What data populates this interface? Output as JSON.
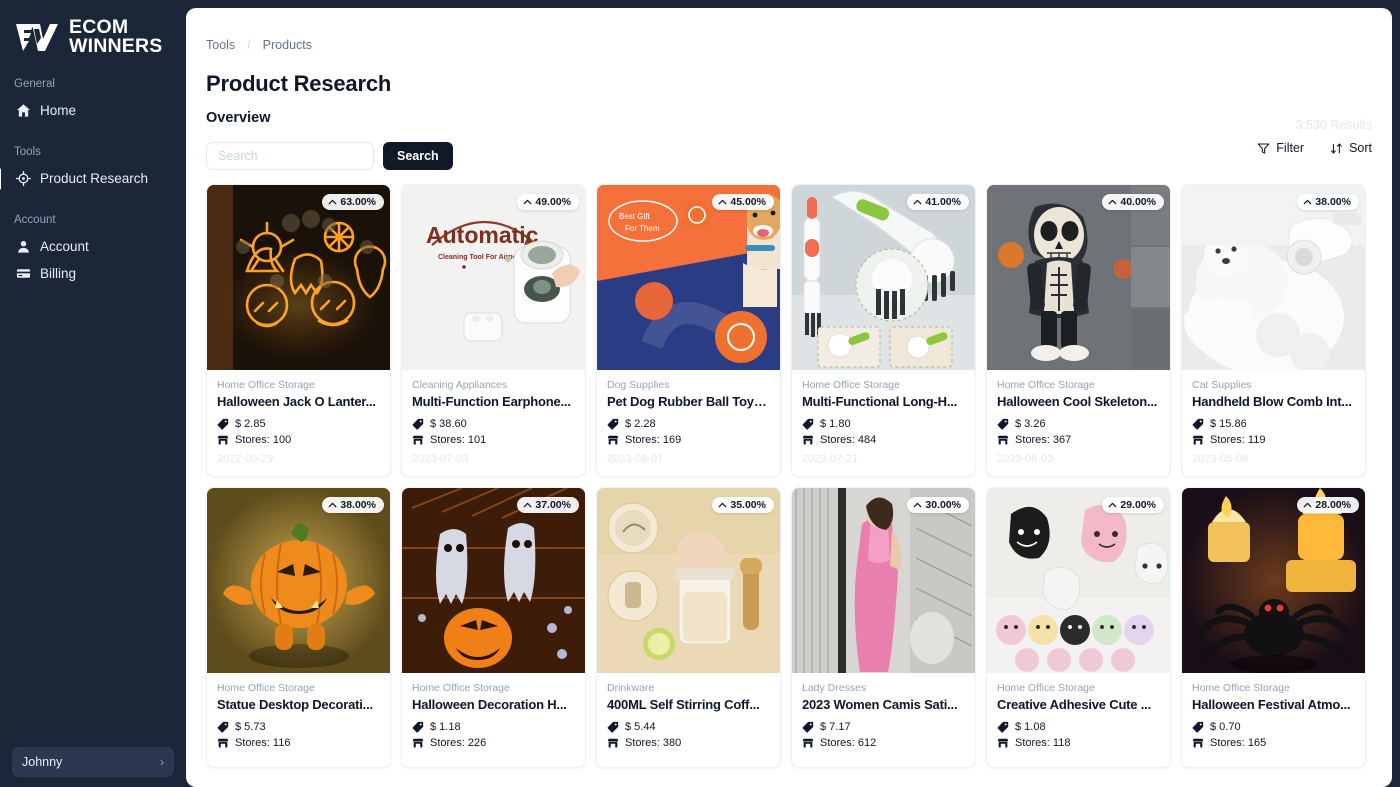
{
  "brand": {
    "name_line1": "ECOM",
    "name_line2": "WINNERS",
    "logo_icon": "ew-logo-icon"
  },
  "sidebar": {
    "sections": [
      {
        "label": "General",
        "items": [
          {
            "label": "Home",
            "icon": "home-icon",
            "active": false
          }
        ]
      },
      {
        "label": "Tools",
        "items": [
          {
            "label": "Product Research",
            "icon": "target-icon",
            "active": true
          }
        ]
      },
      {
        "label": "Account",
        "items": [
          {
            "label": "Account",
            "icon": "user-icon",
            "active": false
          },
          {
            "label": "Billing",
            "icon": "credit-card-icon",
            "active": false
          }
        ]
      }
    ],
    "user": {
      "name": "Johnny",
      "chevron": "›"
    }
  },
  "breadcrumb": {
    "items": [
      "Tools",
      "Products"
    ],
    "separator": "/"
  },
  "header": {
    "title": "Product Research",
    "section": "Overview"
  },
  "search": {
    "value": "",
    "placeholder": "Search",
    "button_label": "Search"
  },
  "toolbar": {
    "results_text": "3.530 Results",
    "filter_label": "Filter",
    "filter_icon": "filter-icon",
    "sort_label": "Sort",
    "sort_icon": "sort-icon"
  },
  "card_meta": {
    "price_icon": "price-tag-icon",
    "stores_icon": "store-icon",
    "badge_caret": "caret-up-icon",
    "stores_prefix": "Stores: ",
    "currency": "$"
  },
  "products": [
    {
      "badge": "63.00%",
      "category": "Home Office Storage",
      "name": "Halloween Jack O Lanter...",
      "price": "$ 2.85",
      "stores": "Stores: 100",
      "date": "2022-09-29",
      "img": "halloween-lights"
    },
    {
      "badge": "49.00%",
      "category": "Cleaning Appliances",
      "name": "Multi-Function Earphone...",
      "price": "$ 38.60",
      "stores": "Stores: 101",
      "date": "2023-07-03",
      "img": "earphone-cleaner"
    },
    {
      "badge": "45.00%",
      "category": "Dog Supplies",
      "name": "Pet Dog Rubber Ball Toys...",
      "price": "$ 2.28",
      "stores": "Stores: 169",
      "date": "2023-08-07",
      "img": "dog-ball"
    },
    {
      "badge": "41.00%",
      "category": "Home Office Storage",
      "name": "Multi-Functional Long-H...",
      "price": "$ 1.80",
      "stores": "Stores: 484",
      "date": "2023-07-21",
      "img": "cleaning-brush"
    },
    {
      "badge": "40.00%",
      "category": "Home Office Storage",
      "name": "Halloween Cool Skeleton...",
      "price": "$ 3.26",
      "stores": "Stores: 367",
      "date": "2023-06-03",
      "img": "skeleton-figure"
    },
    {
      "badge": "38.00%",
      "category": "Cat Supplies",
      "name": "Handheld Blow Comb Int...",
      "price": "$ 15.86",
      "stores": "Stores: 119",
      "date": "2023-05-08",
      "img": "pet-blow-comb"
    },
    {
      "badge": "38.00%",
      "category": "Home Office Storage",
      "name": "Statue Desktop Decorati...",
      "price": "$ 5.73",
      "stores": "Stores: 116",
      "date": "",
      "img": "pumpkin-statue"
    },
    {
      "badge": "37.00%",
      "category": "Home Office Storage",
      "name": "Halloween Decoration H...",
      "price": "$ 1.18",
      "stores": "Stores: 226",
      "date": "",
      "img": "halloween-decor"
    },
    {
      "badge": "35.00%",
      "category": "Drinkware",
      "name": "400ML Self Stirring Coff...",
      "price": "$ 5.44",
      "stores": "Stores: 380",
      "date": "",
      "img": "stirring-cup"
    },
    {
      "badge": "30.00%",
      "category": "Lady Dresses",
      "name": "2023 Women Camis Sati...",
      "price": "$ 7.17",
      "stores": "Stores: 612",
      "date": "",
      "img": "satin-dress"
    },
    {
      "badge": "29.00%",
      "category": "Home Office Storage",
      "name": "Creative Adhesive Cute ...",
      "price": "$ 1.08",
      "stores": "Stores: 118",
      "date": "",
      "img": "cute-hooks"
    },
    {
      "badge": "28.00%",
      "category": "Home Office Storage",
      "name": "Halloween Festival Atmo...",
      "price": "$ 0.70",
      "stores": "Stores: 165",
      "date": "",
      "img": "spider-candle"
    }
  ],
  "colors": {
    "sidebar_bg": "#1c2639",
    "accent_dark": "#111827",
    "muted": "#94a3b8",
    "faint": "#e2e8f0"
  }
}
